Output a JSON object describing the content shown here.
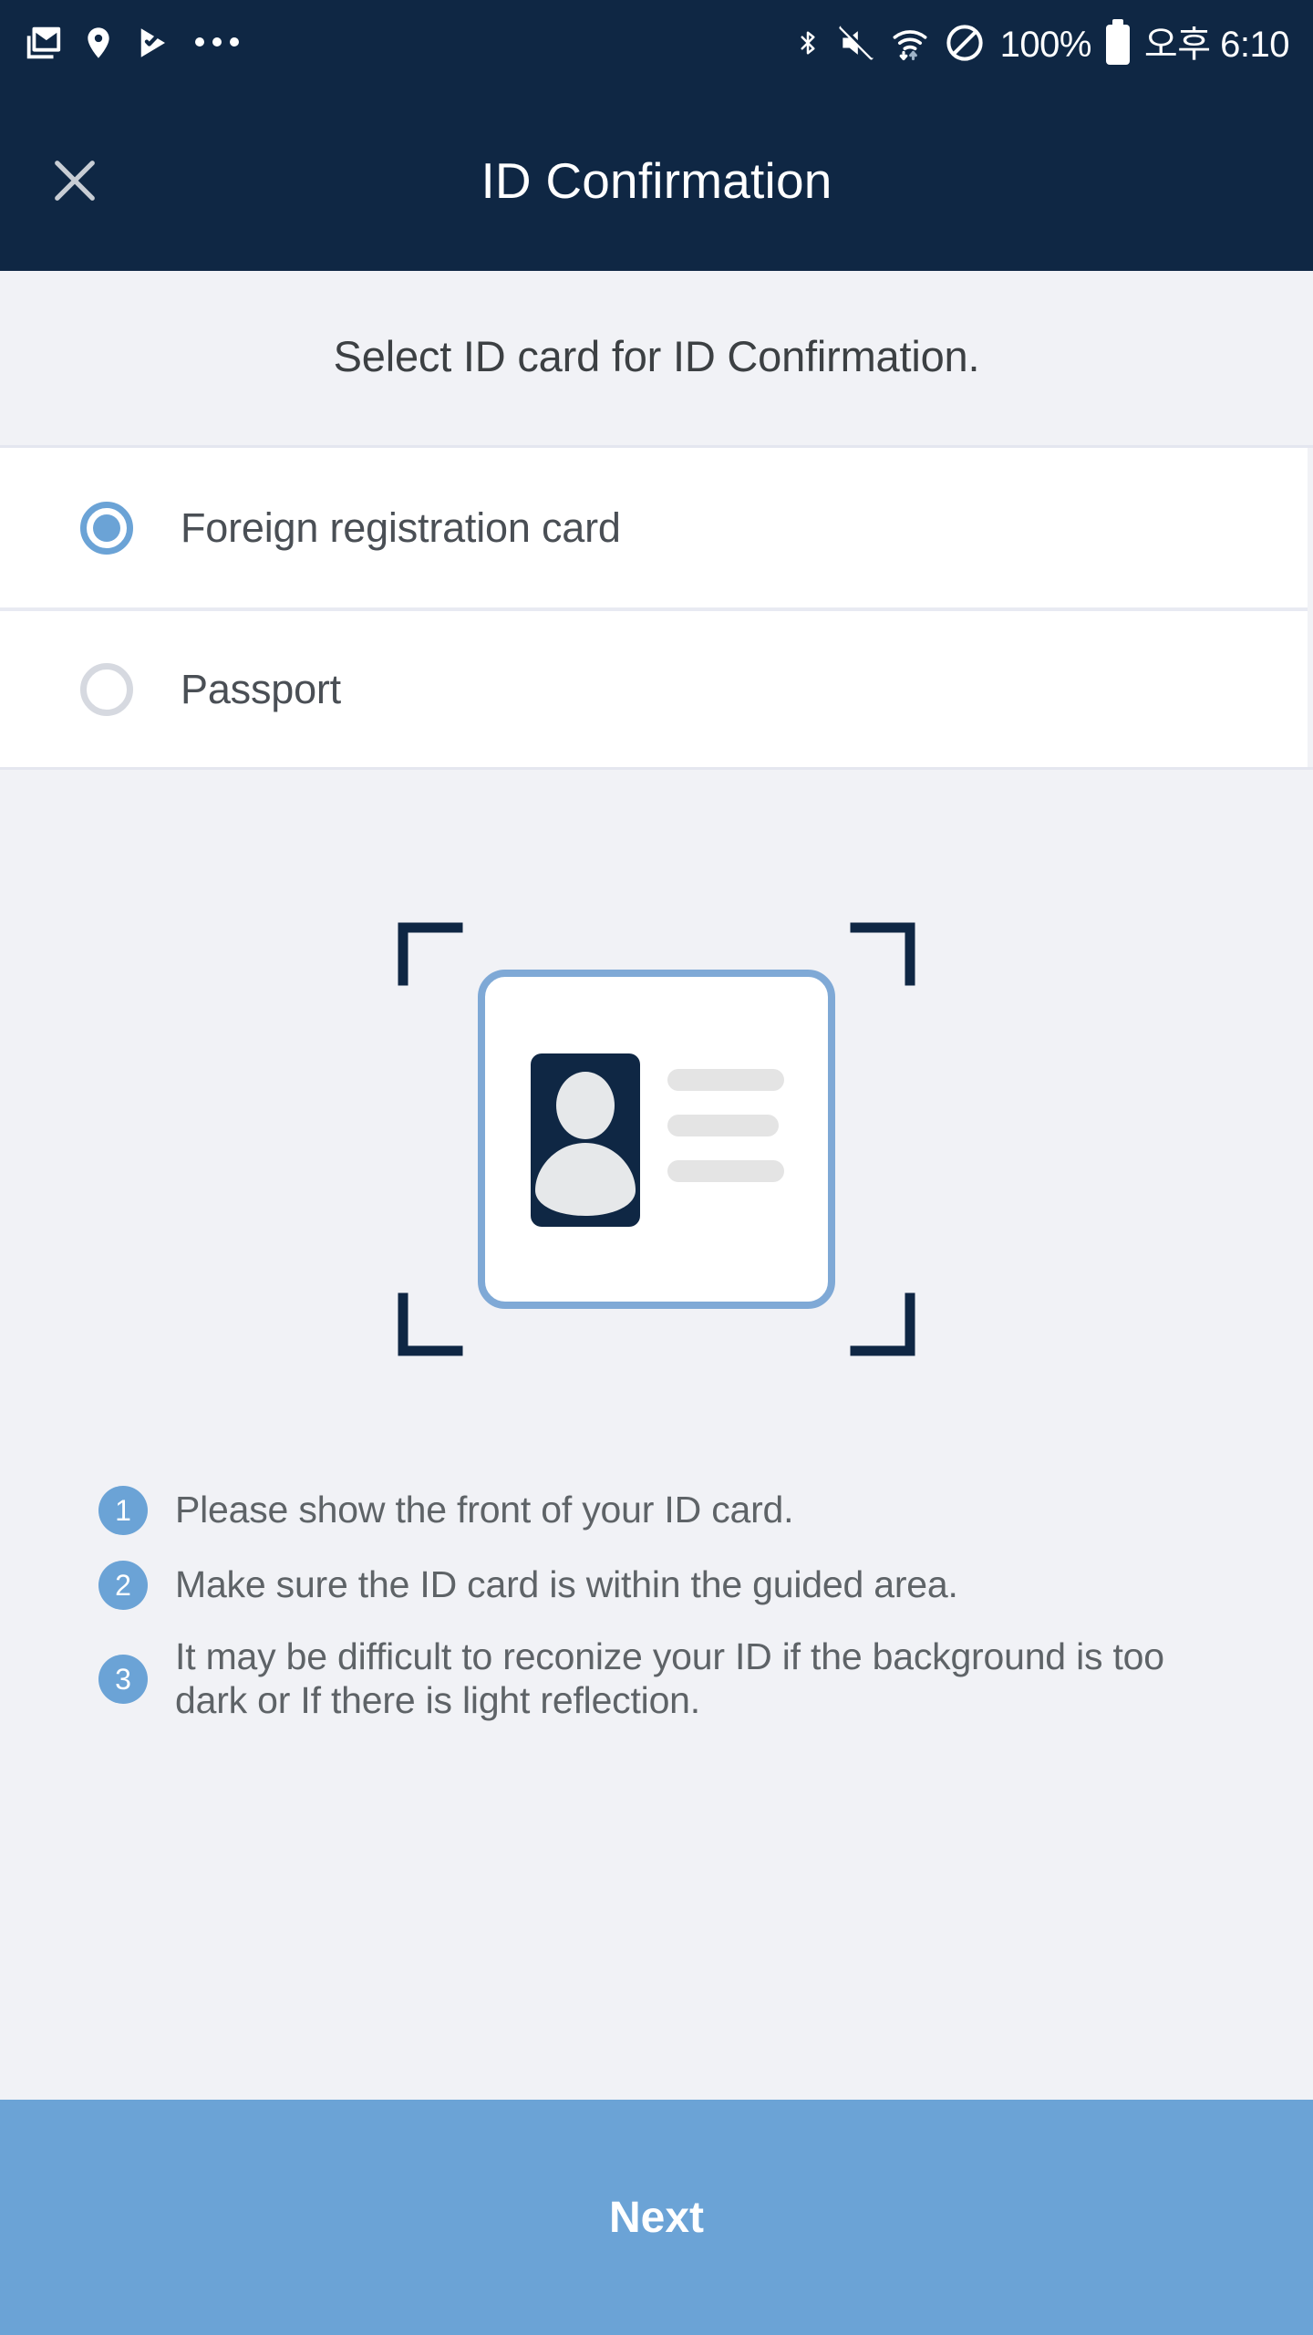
{
  "colors": {
    "header_bg": "#0f2744",
    "page_bg": "#f1f2f6",
    "accent": "#6ba3d6",
    "card_dark": "#0f2744",
    "row_bg": "#ffffff",
    "text_primary": "#3c4043",
    "text_secondary": "#5e6367",
    "placeholder_bar": "#e4e4e4"
  },
  "statusbar": {
    "left_icons": [
      "gmail-icon",
      "location-pin-icon",
      "play-movies-icon",
      "more-icons-overflow"
    ],
    "right_icons": [
      "bluetooth-icon",
      "volume-mute-icon",
      "wifi-icon",
      "do-not-disturb-icon"
    ],
    "battery_percent": "100%",
    "battery_icon": "battery-full-icon",
    "clock": "오후 6:10"
  },
  "header": {
    "title": "ID Confirmation",
    "close_icon": "close-icon"
  },
  "main": {
    "subtitle": "Select ID card for ID Confirmation.",
    "options": [
      {
        "label": "Foreign registration card",
        "selected": true
      },
      {
        "label": "Passport",
        "selected": false
      }
    ],
    "illustration": {
      "name": "id-card-scan-illustration",
      "corner_brackets": 4,
      "photo_placeholder": "person-avatar-icon",
      "text_placeholder_bars": 3
    },
    "notes": [
      {
        "number": "1",
        "text": "Please show the front of your ID card."
      },
      {
        "number": "2",
        "text": "Make sure the ID card is within the guided area."
      },
      {
        "number": "3",
        "text": "It may be difficult to reconize your ID if the background is too dark or If there is light reflection."
      }
    ]
  },
  "footer": {
    "next_label": "Next"
  }
}
